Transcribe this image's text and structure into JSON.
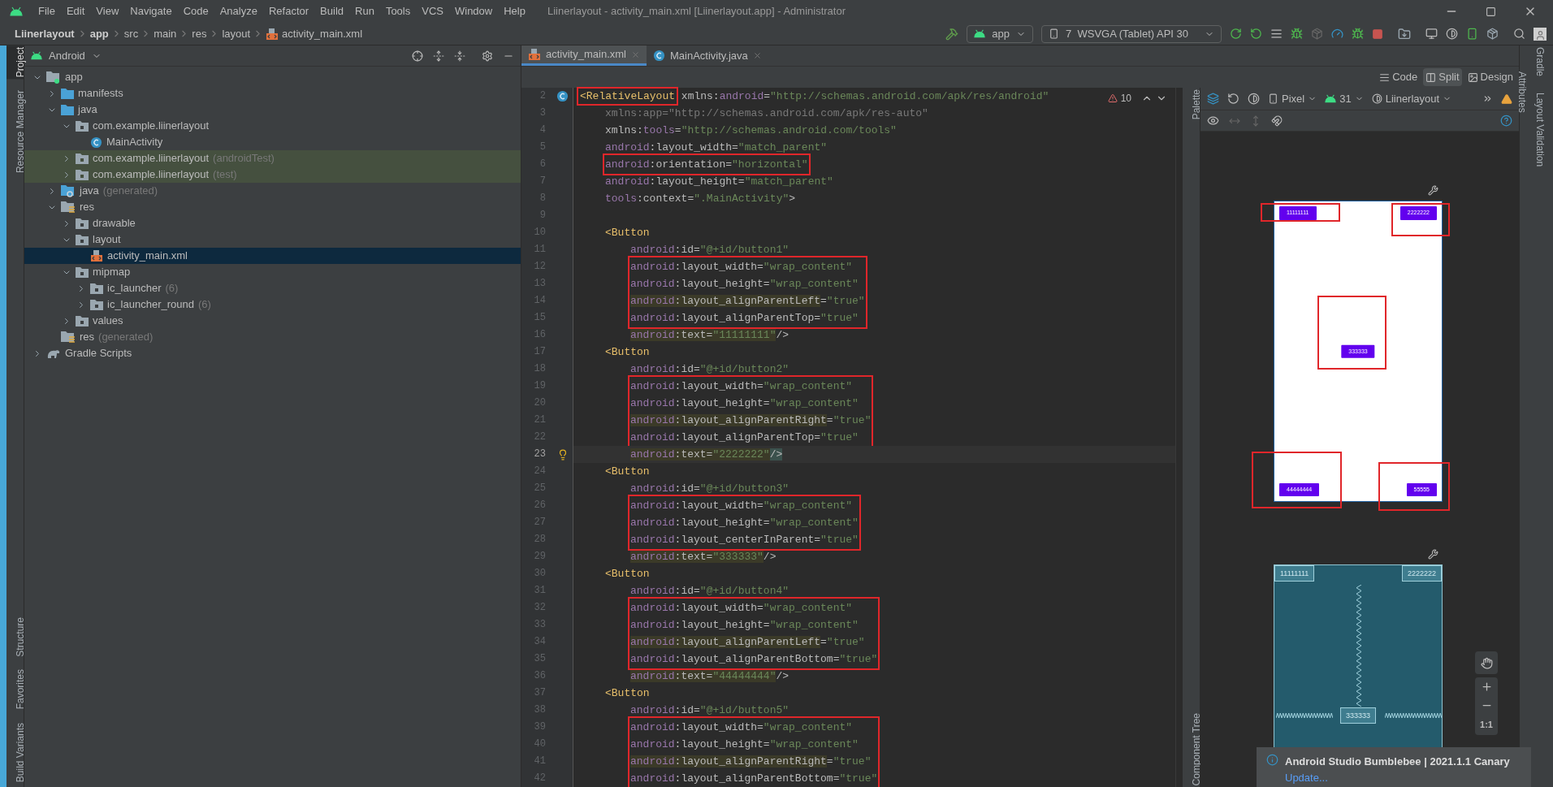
{
  "window": {
    "title": "Liinerlayout - activity_main.xml [Liinerlayout.app] - Administrator"
  },
  "menu": [
    "File",
    "Edit",
    "View",
    "Navigate",
    "Code",
    "Analyze",
    "Refactor",
    "Build",
    "Run",
    "Tools",
    "VCS",
    "Window",
    "Help"
  ],
  "breadcrumb": [
    {
      "label": "Liinerlayout",
      "kind": "project"
    },
    {
      "label": "app",
      "kind": "project"
    },
    {
      "label": "src",
      "kind": "dir"
    },
    {
      "label": "main",
      "kind": "dir"
    },
    {
      "label": "res",
      "kind": "dir"
    },
    {
      "label": "layout",
      "kind": "dir"
    },
    {
      "label": "activity_main.xml",
      "kind": "file"
    }
  ],
  "run_config": "app",
  "device": "7  WSVGA (Tablet) API 30",
  "left_tools_top": [
    {
      "label": "Project",
      "selected": true
    },
    {
      "label": "Resource Manager",
      "selected": false
    }
  ],
  "left_tools_bottom": [
    {
      "label": "Structure",
      "selected": false
    },
    {
      "label": "Favorites",
      "selected": false
    },
    {
      "label": "Build Variants",
      "selected": false
    }
  ],
  "project": {
    "view": "Android",
    "tree": [
      {
        "label": "app",
        "kind": "module",
        "expanded": true,
        "selected": false,
        "scoped": false,
        "children": [
          {
            "label": "manifests",
            "kind": "source",
            "expanded": false,
            "selected": false,
            "scoped": false
          },
          {
            "label": "java",
            "kind": "source",
            "expanded": true,
            "selected": false,
            "scoped": false,
            "children": [
              {
                "label": "com.example.liinerlayout",
                "kind": "package",
                "expanded": true,
                "selected": false,
                "scoped": false,
                "children": [
                  {
                    "label": "MainActivity",
                    "kind": "class",
                    "selected": false,
                    "scoped": false
                  }
                ]
              },
              {
                "label": "com.example.liinerlayout",
                "suffix": "(androidTest)",
                "kind": "package",
                "expanded": false,
                "selected": false,
                "scoped": true
              },
              {
                "label": "com.example.liinerlayout",
                "suffix": "(test)",
                "kind": "package",
                "expanded": false,
                "selected": false,
                "scoped": true
              }
            ]
          },
          {
            "label": "java",
            "suffix": "(generated)",
            "kind": "generated",
            "expanded": false,
            "selected": false,
            "scoped": false
          },
          {
            "label": "res",
            "kind": "resources",
            "expanded": true,
            "selected": false,
            "scoped": false,
            "children": [
              {
                "label": "drawable",
                "kind": "package",
                "expanded": false,
                "selected": false,
                "scoped": false
              },
              {
                "label": "layout",
                "kind": "package",
                "expanded": true,
                "selected": false,
                "scoped": false,
                "children": [
                  {
                    "label": "activity_main.xml",
                    "kind": "layout-file",
                    "selected": true,
                    "scoped": false
                  }
                ]
              },
              {
                "label": "mipmap",
                "kind": "package",
                "expanded": true,
                "selected": false,
                "scoped": false,
                "children": [
                  {
                    "label": "ic_launcher",
                    "suffix": "(6)",
                    "kind": "package",
                    "expanded": false,
                    "selected": false,
                    "scoped": false
                  },
                  {
                    "label": "ic_launcher_round",
                    "suffix": "(6)",
                    "kind": "package",
                    "expanded": false,
                    "selected": false,
                    "scoped": false
                  }
                ]
              },
              {
                "label": "values",
                "kind": "package",
                "expanded": false,
                "selected": false,
                "scoped": false
              }
            ]
          },
          {
            "label": "res",
            "suffix": "(generated)",
            "kind": "resources",
            "selected": false,
            "scoped": false
          }
        ]
      },
      {
        "label": "Gradle Scripts",
        "kind": "gradle",
        "expanded": false,
        "selected": false,
        "scoped": false
      }
    ]
  },
  "editor_tabs": [
    {
      "label": "activity_main.xml",
      "kind": "layout-file",
      "selected": true
    },
    {
      "label": "MainActivity.java",
      "kind": "class",
      "selected": false
    }
  ],
  "view_modes": [
    {
      "label": "Code",
      "selected": false
    },
    {
      "label": "Split",
      "selected": true
    },
    {
      "label": "Design",
      "selected": false
    }
  ],
  "inspections": {
    "count": "10"
  },
  "code": [
    {
      "n": "2",
      "kind": "root",
      "boxed": false,
      "current": false,
      "marker": {
        "kind": "class"
      },
      "parts": [
        {
          "t": "<RelativeLayout",
          "kind": "tagbox"
        },
        {
          "t": " xmlns:",
          "kind": "plain"
        },
        {
          "t": "android",
          "kind": "ns"
        },
        {
          "t": "=",
          "kind": "plain"
        },
        {
          "t": "\"http://schemas.android.com/apk/res/android\"",
          "kind": "val"
        }
      ]
    },
    {
      "n": "3",
      "kind": "rattr",
      "boxed": false,
      "current": false,
      "parts": [
        {
          "t": "xmlns:app=",
          "kind": "dim"
        },
        {
          "t": "\"http://schemas.android.com/apk/res-auto\"",
          "kind": "dim"
        }
      ]
    },
    {
      "n": "4",
      "kind": "rattr",
      "boxed": false,
      "current": false,
      "parts": [
        {
          "t": "xmlns:",
          "kind": "plain"
        },
        {
          "t": "tools",
          "kind": "ns"
        },
        {
          "t": "=",
          "kind": "plain"
        },
        {
          "t": "\"http://schemas.android.com/tools\"",
          "kind": "val"
        }
      ]
    },
    {
      "n": "5",
      "kind": "rattr",
      "boxed": false,
      "current": false,
      "parts": [
        {
          "t": "android",
          "kind": "ns"
        },
        {
          "t": ":layout_width=",
          "kind": "plain"
        },
        {
          "t": "\"match_parent\"",
          "kind": "val"
        }
      ]
    },
    {
      "n": "6",
      "kind": "rattr",
      "boxed": true,
      "current": false,
      "parts": [
        {
          "t": "android",
          "kind": "ns"
        },
        {
          "t": ":orientation=",
          "kind": "plain"
        },
        {
          "t": "\"horizontal\"",
          "kind": "val"
        }
      ]
    },
    {
      "n": "7",
      "kind": "rattr",
      "boxed": false,
      "current": false,
      "parts": [
        {
          "t": "android",
          "kind": "ns"
        },
        {
          "t": ":layout_height=",
          "kind": "plain"
        },
        {
          "t": "\"match_parent\"",
          "kind": "val"
        }
      ]
    },
    {
      "n": "8",
      "kind": "rattr",
      "boxed": false,
      "current": false,
      "parts": [
        {
          "t": "tools",
          "kind": "ns"
        },
        {
          "t": ":context=",
          "kind": "plain"
        },
        {
          "t": "\".MainActivity\"",
          "kind": "val"
        },
        {
          "t": ">",
          "kind": "plain"
        }
      ]
    },
    {
      "n": "9",
      "kind": "root",
      "boxed": false,
      "current": false
    },
    {
      "n": "10",
      "kind": "child",
      "boxed": false,
      "current": false,
      "parts": [
        {
          "t": "<Button",
          "kind": "tag"
        }
      ]
    },
    {
      "n": "11",
      "kind": "cattr",
      "boxed": false,
      "current": false,
      "parts": [
        {
          "t": "android",
          "kind": "ns"
        },
        {
          "t": ":id=",
          "kind": "plain"
        },
        {
          "t": "\"@+id/button1\"",
          "kind": "val"
        }
      ]
    },
    {
      "n": "12",
      "kind": "cattr",
      "boxed": true,
      "current": false,
      "parts": [
        {
          "t": "android",
          "kind": "ns"
        },
        {
          "t": ":layout_width=",
          "kind": "plain"
        },
        {
          "t": "\"wrap_content\"",
          "kind": "val"
        }
      ]
    },
    {
      "n": "13",
      "kind": "cattr",
      "boxed": true,
      "current": false,
      "parts": [
        {
          "t": "android",
          "kind": "ns"
        },
        {
          "t": ":layout_height=",
          "kind": "plain"
        },
        {
          "t": "\"wrap_content\"",
          "kind": "val"
        }
      ]
    },
    {
      "n": "14",
      "kind": "cattr",
      "boxed": true,
      "current": false,
      "parts": [
        {
          "t": "android",
          "kind": "nshl"
        },
        {
          "t": ":layout_alignParentLeft",
          "kind": "plainhl"
        },
        {
          "t": "=",
          "kind": "plain"
        },
        {
          "t": "\"true\"",
          "kind": "val"
        }
      ]
    },
    {
      "n": "15",
      "kind": "cattr",
      "boxed": true,
      "current": false,
      "parts": [
        {
          "t": "android",
          "kind": "ns"
        },
        {
          "t": ":layout_alignParentTop=",
          "kind": "plain"
        },
        {
          "t": "\"true\"",
          "kind": "val"
        }
      ]
    },
    {
      "n": "16",
      "kind": "cattr",
      "boxed": false,
      "current": false,
      "parts": [
        {
          "t": "android",
          "kind": "nshl"
        },
        {
          "t": ":text=",
          "kind": "plainhl"
        },
        {
          "t": "\"11111111\"",
          "kind": "valhl"
        },
        {
          "t": "/>",
          "kind": "plain"
        }
      ]
    },
    {
      "n": "17",
      "kind": "child",
      "boxed": false,
      "current": false,
      "parts": [
        {
          "t": "<Button",
          "kind": "tag"
        }
      ]
    },
    {
      "n": "18",
      "kind": "cattr",
      "boxed": false,
      "current": false,
      "parts": [
        {
          "t": "android",
          "kind": "ns"
        },
        {
          "t": ":id=",
          "kind": "plain"
        },
        {
          "t": "\"@+id/button2\"",
          "kind": "val"
        }
      ]
    },
    {
      "n": "19",
      "kind": "cattr",
      "boxed": true,
      "current": false,
      "parts": [
        {
          "t": "android",
          "kind": "ns"
        },
        {
          "t": ":layout_width=",
          "kind": "plain"
        },
        {
          "t": "\"wrap_content\"",
          "kind": "val"
        }
      ]
    },
    {
      "n": "20",
      "kind": "cattr",
      "boxed": true,
      "current": false,
      "parts": [
        {
          "t": "android",
          "kind": "ns"
        },
        {
          "t": ":layout_height=",
          "kind": "plain"
        },
        {
          "t": "\"wrap_content\"",
          "kind": "val"
        }
      ]
    },
    {
      "n": "21",
      "kind": "cattr",
      "boxed": true,
      "current": false,
      "parts": [
        {
          "t": "android",
          "kind": "nshl"
        },
        {
          "t": ":layout_alignParentRight",
          "kind": "plainhl"
        },
        {
          "t": "=",
          "kind": "plain"
        },
        {
          "t": "\"true\"",
          "kind": "val"
        }
      ]
    },
    {
      "n": "22",
      "kind": "cattr",
      "boxed": true,
      "current": false,
      "parts": [
        {
          "t": "android",
          "kind": "ns"
        },
        {
          "t": ":layout_alignParentTop=",
          "kind": "plain"
        },
        {
          "t": "\"true\"",
          "kind": "val"
        }
      ]
    },
    {
      "n": "23",
      "kind": "cattr",
      "boxed": false,
      "current": true,
      "marker": {
        "kind": "bulb"
      },
      "parts": [
        {
          "t": "android",
          "kind": "nshl"
        },
        {
          "t": ":text=",
          "kind": "plainhl"
        },
        {
          "t": "\"2222222\"",
          "kind": "valhl"
        },
        {
          "t": "/>",
          "kind": "bracehl"
        }
      ]
    },
    {
      "n": "24",
      "kind": "child",
      "boxed": false,
      "current": false,
      "parts": [
        {
          "t": "<Button",
          "kind": "tag"
        }
      ]
    },
    {
      "n": "25",
      "kind": "cattr",
      "boxed": false,
      "current": false,
      "parts": [
        {
          "t": "android",
          "kind": "ns"
        },
        {
          "t": ":id=",
          "kind": "plain"
        },
        {
          "t": "\"@+id/button3\"",
          "kind": "val"
        }
      ]
    },
    {
      "n": "26",
      "kind": "cattr",
      "boxed": true,
      "current": false,
      "parts": [
        {
          "t": "android",
          "kind": "ns"
        },
        {
          "t": ":layout_width=",
          "kind": "plain"
        },
        {
          "t": "\"wrap_content\"",
          "kind": "val"
        }
      ]
    },
    {
      "n": "27",
      "kind": "cattr",
      "boxed": true,
      "current": false,
      "parts": [
        {
          "t": "android",
          "kind": "ns"
        },
        {
          "t": ":layout_height=",
          "kind": "plain"
        },
        {
          "t": "\"wrap_content\"",
          "kind": "val"
        }
      ]
    },
    {
      "n": "28",
      "kind": "cattr",
      "boxed": true,
      "current": false,
      "parts": [
        {
          "t": "android",
          "kind": "ns"
        },
        {
          "t": ":layout_centerInParent=",
          "kind": "plain"
        },
        {
          "t": "\"true\"",
          "kind": "val"
        }
      ]
    },
    {
      "n": "29",
      "kind": "cattr",
      "boxed": false,
      "current": false,
      "parts": [
        {
          "t": "android",
          "kind": "nshl"
        },
        {
          "t": ":text=",
          "kind": "plainhl"
        },
        {
          "t": "\"333333\"",
          "kind": "valhl"
        },
        {
          "t": "/>",
          "kind": "plain"
        }
      ]
    },
    {
      "n": "30",
      "kind": "child",
      "boxed": false,
      "current": false,
      "parts": [
        {
          "t": "<Button",
          "kind": "tag"
        }
      ]
    },
    {
      "n": "31",
      "kind": "cattr",
      "boxed": false,
      "current": false,
      "parts": [
        {
          "t": "android",
          "kind": "ns"
        },
        {
          "t": ":id=",
          "kind": "plain"
        },
        {
          "t": "\"@+id/button4\"",
          "kind": "val"
        }
      ]
    },
    {
      "n": "32",
      "kind": "cattr",
      "boxed": true,
      "current": false,
      "parts": [
        {
          "t": "android",
          "kind": "ns"
        },
        {
          "t": ":layout_width=",
          "kind": "plain"
        },
        {
          "t": "\"wrap_content\"",
          "kind": "val"
        }
      ]
    },
    {
      "n": "33",
      "kind": "cattr",
      "boxed": true,
      "current": false,
      "parts": [
        {
          "t": "android",
          "kind": "ns"
        },
        {
          "t": ":layout_height=",
          "kind": "plain"
        },
        {
          "t": "\"wrap_content\"",
          "kind": "val"
        }
      ]
    },
    {
      "n": "34",
      "kind": "cattr",
      "boxed": true,
      "current": false,
      "parts": [
        {
          "t": "android",
          "kind": "nshl"
        },
        {
          "t": ":layout_alignParentLeft",
          "kind": "plainhl"
        },
        {
          "t": "=",
          "kind": "plain"
        },
        {
          "t": "\"true\"",
          "kind": "val"
        }
      ]
    },
    {
      "n": "35",
      "kind": "cattr",
      "boxed": true,
      "current": false,
      "parts": [
        {
          "t": "android",
          "kind": "ns"
        },
        {
          "t": ":layout_alignParentBottom=",
          "kind": "plain"
        },
        {
          "t": "\"true\"",
          "kind": "val"
        }
      ]
    },
    {
      "n": "36",
      "kind": "cattr",
      "boxed": false,
      "current": false,
      "parts": [
        {
          "t": "android",
          "kind": "nshl"
        },
        {
          "t": ":text=",
          "kind": "plainhl"
        },
        {
          "t": "\"44444444\"",
          "kind": "valhl"
        },
        {
          "t": "/>",
          "kind": "plain"
        }
      ]
    },
    {
      "n": "37",
      "kind": "child",
      "boxed": false,
      "current": false,
      "parts": [
        {
          "t": "<Button",
          "kind": "tag"
        }
      ]
    },
    {
      "n": "38",
      "kind": "cattr",
      "boxed": false,
      "current": false,
      "parts": [
        {
          "t": "android",
          "kind": "ns"
        },
        {
          "t": ":id=",
          "kind": "plain"
        },
        {
          "t": "\"@+id/button5\"",
          "kind": "val"
        }
      ]
    },
    {
      "n": "39",
      "kind": "cattr",
      "boxed": true,
      "current": false,
      "parts": [
        {
          "t": "android",
          "kind": "ns"
        },
        {
          "t": ":layout_width=",
          "kind": "plain"
        },
        {
          "t": "\"wrap_content\"",
          "kind": "val"
        }
      ]
    },
    {
      "n": "40",
      "kind": "cattr",
      "boxed": true,
      "current": false,
      "parts": [
        {
          "t": "android",
          "kind": "ns"
        },
        {
          "t": ":layout_height=",
          "kind": "plain"
        },
        {
          "t": "\"wrap_content\"",
          "kind": "val"
        }
      ]
    },
    {
      "n": "41",
      "kind": "cattr",
      "boxed": true,
      "current": false,
      "parts": [
        {
          "t": "android",
          "kind": "nshl"
        },
        {
          "t": ":layout_alignParentRight",
          "kind": "plainhl"
        },
        {
          "t": "=",
          "kind": "plain"
        },
        {
          "t": "\"true\"",
          "kind": "val"
        }
      ]
    },
    {
      "n": "42",
      "kind": "cattr",
      "boxed": true,
      "current": false,
      "parts": [
        {
          "t": "android",
          "kind": "ns"
        },
        {
          "t": ":layout_alignParentBottom=",
          "kind": "plain"
        },
        {
          "t": "\"true\"",
          "kind": "val"
        }
      ]
    }
  ],
  "design": {
    "side_tools": [
      "Palette",
      "Component Tree"
    ],
    "device": "Pixel",
    "api": "31",
    "theme": "Liinerlayout",
    "preview_buttons": [
      {
        "label": "11111111",
        "kind": "top-left"
      },
      {
        "label": "2222222",
        "kind": "top-right"
      },
      {
        "label": "333333",
        "kind": "center"
      },
      {
        "label": "44444444",
        "kind": "bottom-left"
      },
      {
        "label": "55555",
        "kind": "bottom-right"
      }
    ],
    "blueprint_buttons": [
      {
        "label": "11111111",
        "kind": "top-left"
      },
      {
        "label": "2222222",
        "kind": "top-right"
      },
      {
        "label": "333333",
        "kind": "center"
      }
    ],
    "zoom_reset": "1:1"
  },
  "right_tools_outer": [
    "Gradle",
    "Layout Validation"
  ],
  "right_tools_inner": [
    "Attributes"
  ],
  "notification": {
    "title": "Android Studio Bumblebee | 2021.1.1 Canary",
    "link": "Update..."
  }
}
